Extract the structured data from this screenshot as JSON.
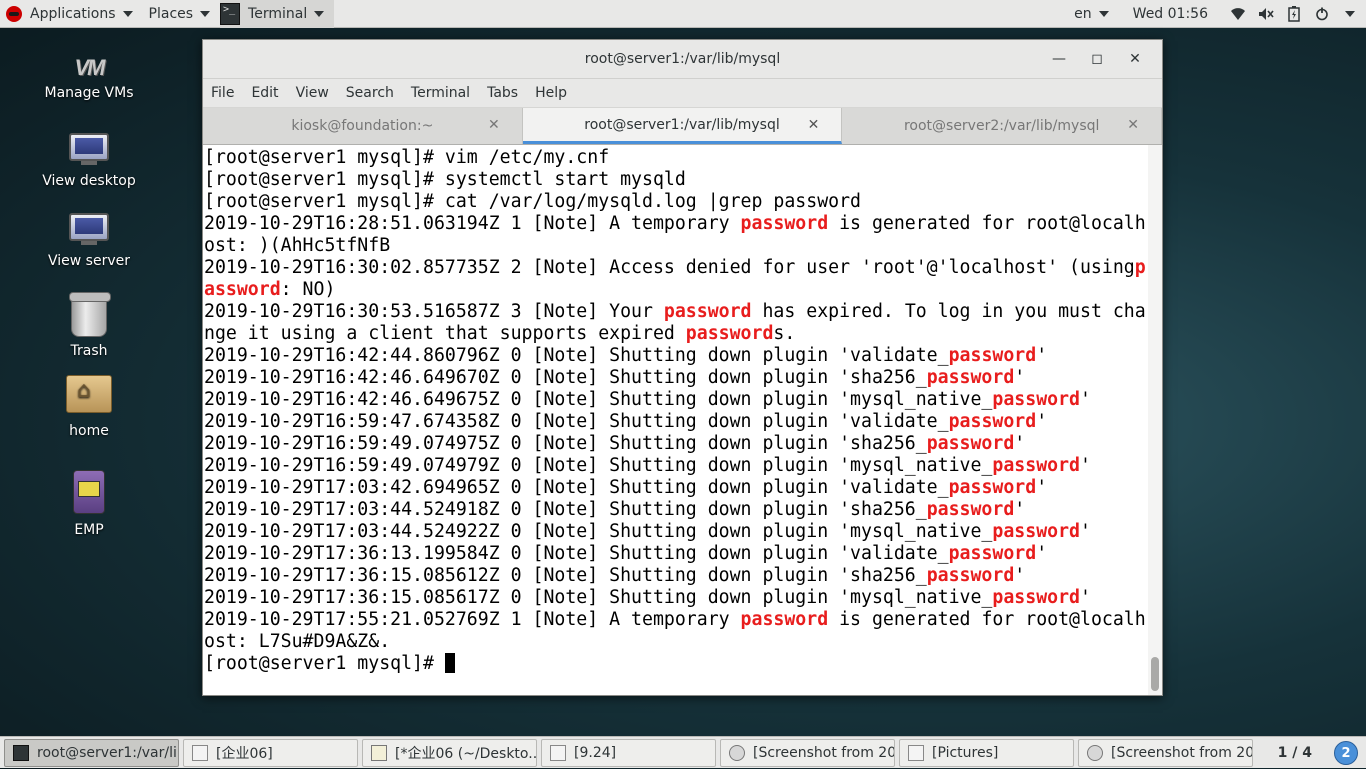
{
  "topbar": {
    "applications": "Applications",
    "places": "Places",
    "terminal_app": "Terminal",
    "lang": "en",
    "clock": "Wed 01:56",
    "sys_icons": [
      "network-icon",
      "volume-icon",
      "battery-icon",
      "power-icon"
    ]
  },
  "desktop_icons": [
    {
      "label": "Manage VMs"
    },
    {
      "label": "View desktop"
    },
    {
      "label": "View server"
    },
    {
      "label": "Trash"
    },
    {
      "label": "home"
    },
    {
      "label": "EMP"
    }
  ],
  "window": {
    "title": "root@server1:/var/lib/mysql",
    "menu": [
      "File",
      "Edit",
      "View",
      "Search",
      "Terminal",
      "Tabs",
      "Help"
    ],
    "tabs": [
      {
        "label": "kiosk@foundation:~",
        "active": false
      },
      {
        "label": "root@server1:/var/lib/mysql",
        "active": true
      },
      {
        "label": "root@server2:/var/lib/mysql",
        "active": false
      }
    ]
  },
  "terminal": {
    "highlight_color": "#e81d1d",
    "lines": [
      [
        {
          "t": "[root@server1 mysql]# vim /etc/my.cnf"
        }
      ],
      [
        {
          "t": "[root@server1 mysql]# systemctl start mysqld"
        }
      ],
      [
        {
          "t": "[root@server1 mysql]# cat /var/log/mysqld.log |grep password"
        }
      ],
      [
        {
          "t": "2019-10-29T16:28:51.063194Z 1 [Note] A temporary "
        },
        {
          "t": "password",
          "hl": true
        },
        {
          "t": " is generated for root@localh"
        }
      ],
      [
        {
          "t": "ost: )(AhHc5tfNfB"
        }
      ],
      [
        {
          "t": "2019-10-29T16:30:02.857735Z 2 [Note] Access denied for user 'root'@'localhost' (using"
        },
        {
          "t": "p",
          "hl": true
        }
      ],
      [
        {
          "t": "assword",
          "hl": true
        },
        {
          "t": ": NO)"
        }
      ],
      [
        {
          "t": "2019-10-29T16:30:53.516587Z 3 [Note] Your "
        },
        {
          "t": "password",
          "hl": true
        },
        {
          "t": " has expired. To log in you must cha"
        }
      ],
      [
        {
          "t": "nge it using a client that supports expired "
        },
        {
          "t": "password",
          "hl": true
        },
        {
          "t": "s."
        }
      ],
      [
        {
          "t": "2019-10-29T16:42:44.860796Z 0 [Note] Shutting down plugin 'validate_"
        },
        {
          "t": "password",
          "hl": true
        },
        {
          "t": "'"
        }
      ],
      [
        {
          "t": "2019-10-29T16:42:46.649670Z 0 [Note] Shutting down plugin 'sha256_"
        },
        {
          "t": "password",
          "hl": true
        },
        {
          "t": "'"
        }
      ],
      [
        {
          "t": "2019-10-29T16:42:46.649675Z 0 [Note] Shutting down plugin 'mysql_native_"
        },
        {
          "t": "password",
          "hl": true
        },
        {
          "t": "'"
        }
      ],
      [
        {
          "t": "2019-10-29T16:59:47.674358Z 0 [Note] Shutting down plugin 'validate_"
        },
        {
          "t": "password",
          "hl": true
        },
        {
          "t": "'"
        }
      ],
      [
        {
          "t": "2019-10-29T16:59:49.074975Z 0 [Note] Shutting down plugin 'sha256_"
        },
        {
          "t": "password",
          "hl": true
        },
        {
          "t": "'"
        }
      ],
      [
        {
          "t": "2019-10-29T16:59:49.074979Z 0 [Note] Shutting down plugin 'mysql_native_"
        },
        {
          "t": "password",
          "hl": true
        },
        {
          "t": "'"
        }
      ],
      [
        {
          "t": "2019-10-29T17:03:42.694965Z 0 [Note] Shutting down plugin 'validate_"
        },
        {
          "t": "password",
          "hl": true
        },
        {
          "t": "'"
        }
      ],
      [
        {
          "t": "2019-10-29T17:03:44.524918Z 0 [Note] Shutting down plugin 'sha256_"
        },
        {
          "t": "password",
          "hl": true
        },
        {
          "t": "'"
        }
      ],
      [
        {
          "t": "2019-10-29T17:03:44.524922Z 0 [Note] Shutting down plugin 'mysql_native_"
        },
        {
          "t": "password",
          "hl": true
        },
        {
          "t": "'"
        }
      ],
      [
        {
          "t": "2019-10-29T17:36:13.199584Z 0 [Note] Shutting down plugin 'validate_"
        },
        {
          "t": "password",
          "hl": true
        },
        {
          "t": "'"
        }
      ],
      [
        {
          "t": "2019-10-29T17:36:15.085612Z 0 [Note] Shutting down plugin 'sha256_"
        },
        {
          "t": "password",
          "hl": true
        },
        {
          "t": "'"
        }
      ],
      [
        {
          "t": "2019-10-29T17:36:15.085617Z 0 [Note] Shutting down plugin 'mysql_native_"
        },
        {
          "t": "password",
          "hl": true
        },
        {
          "t": "'"
        }
      ],
      [
        {
          "t": "2019-10-29T17:55:21.052769Z 1 [Note] A temporary "
        },
        {
          "t": "password",
          "hl": true
        },
        {
          "t": " is generated for root@localh"
        }
      ],
      [
        {
          "t": "ost: L7Su#D9A&Z&."
        }
      ],
      [
        {
          "t": "[root@server1 mysql]# "
        }
      ]
    ]
  },
  "taskbar": {
    "tasks": [
      {
        "label": "root@server1:/var/li...",
        "icon": "terminal-icon",
        "active": true
      },
      {
        "label": "[企业06]",
        "icon": "document-icon",
        "active": false
      },
      {
        "label": "[*企业06 (~/Deskto...",
        "icon": "text-editor-icon",
        "active": false
      },
      {
        "label": "[9.24]",
        "icon": "document-icon",
        "active": false
      },
      {
        "label": "[Screenshot from 20...",
        "icon": "image-viewer-icon",
        "active": false
      },
      {
        "label": "[Pictures]",
        "icon": "document-icon",
        "active": false
      },
      {
        "label": "[Screenshot from 20...",
        "icon": "image-viewer-icon",
        "active": false
      }
    ],
    "pager": "1 / 4",
    "badge": "2"
  }
}
